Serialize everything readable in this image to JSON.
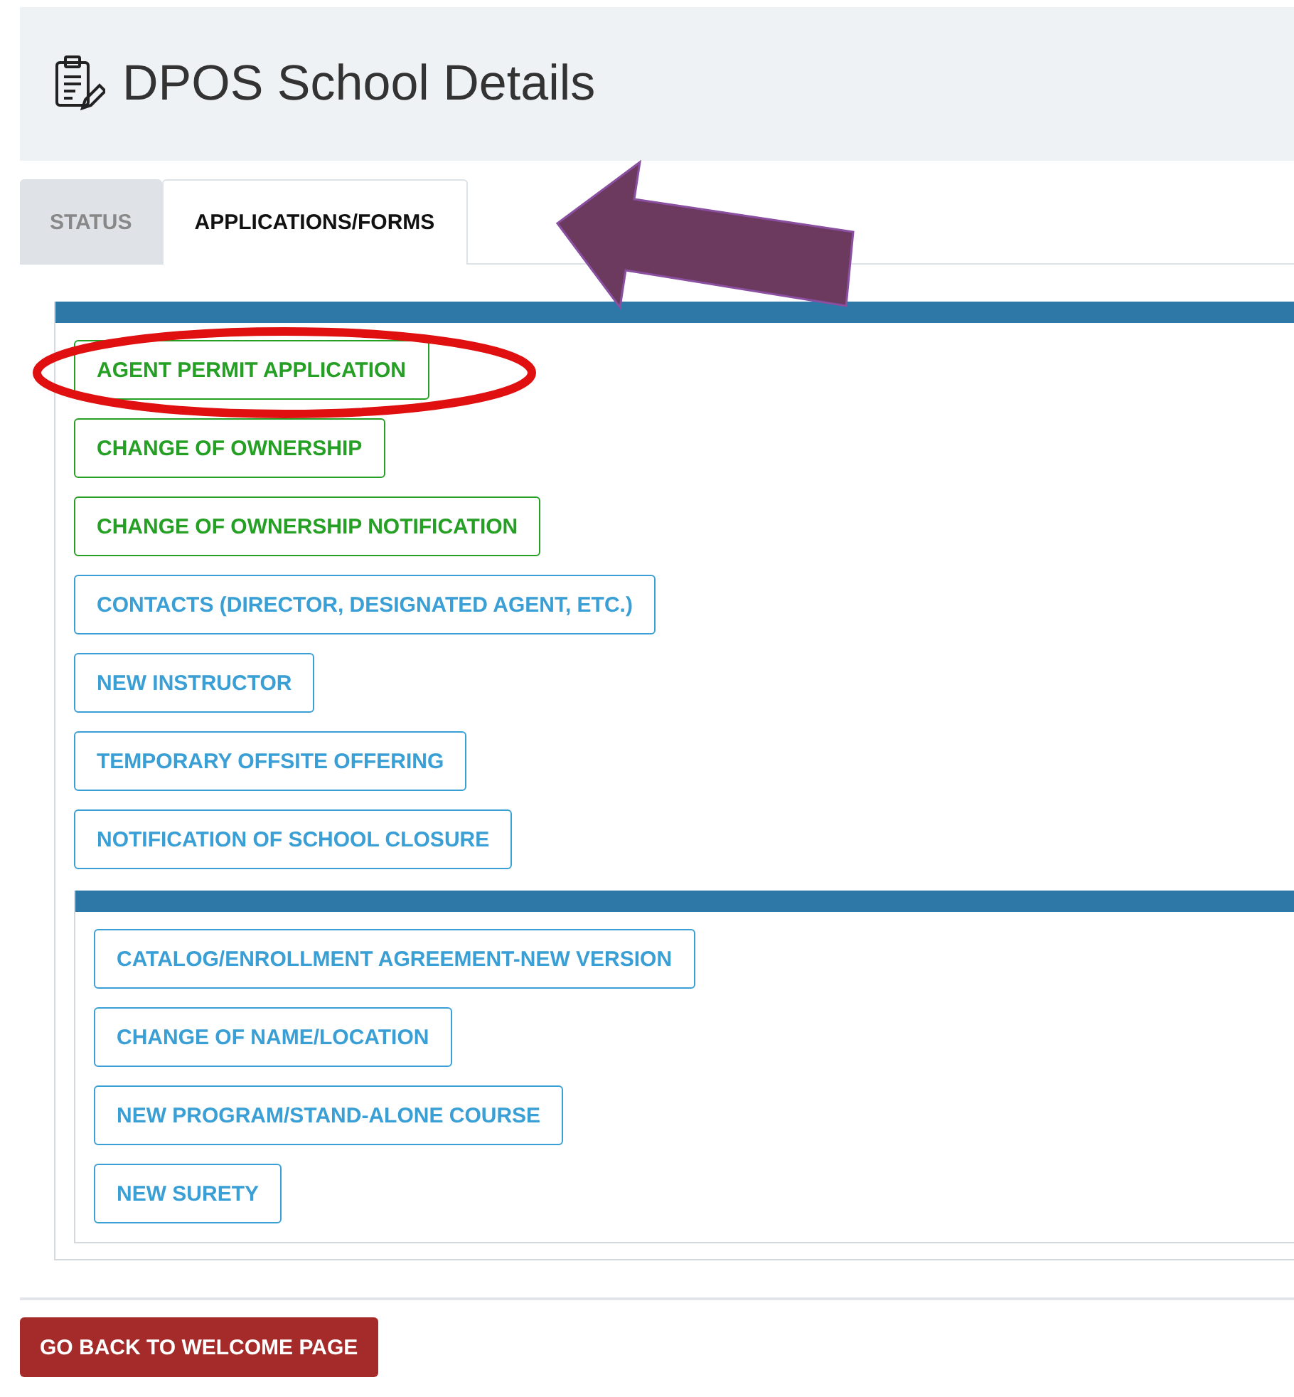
{
  "header": {
    "title": "DPOS School Details"
  },
  "tabs": [
    {
      "label": "STATUS",
      "selected": false
    },
    {
      "label": "APPLICATIONS/FORMS",
      "selected": true
    }
  ],
  "forms": [
    {
      "label": "AGENT PERMIT APPLICATION",
      "color": "#25a025"
    },
    {
      "label": "CHANGE OF OWNERSHIP",
      "color": "#25a025"
    },
    {
      "label": "CHANGE OF OWNERSHIP NOTIFICATION",
      "color": "#25a025"
    },
    {
      "label": "CONTACTS (DIRECTOR, DESIGNATED AGENT, ETC.)",
      "color": "#3a9fd5"
    },
    {
      "label": "NEW INSTRUCTOR",
      "color": "#3a9fd5"
    },
    {
      "label": "TEMPORARY OFFSITE OFFERING",
      "color": "#3a9fd5"
    },
    {
      "label": "NOTIFICATION OF SCHOOL CLOSURE",
      "color": "#3a9fd5"
    }
  ],
  "program_forms": [
    {
      "label": "CATALOG/ENROLLMENT AGREEMENT-NEW VERSION",
      "color": "#3a9fd5"
    },
    {
      "label": "CHANGE OF NAME/LOCATION",
      "color": "#3a9fd5"
    },
    {
      "label": "NEW PROGRAM/STAND-ALONE COURSE",
      "color": "#3a9fd5"
    },
    {
      "label": "NEW SURETY",
      "color": "#3a9fd5"
    }
  ],
  "back_button": "GO BACK TO WELCOME PAGE",
  "annotations": [
    {
      "kind": "ellipse",
      "color": "#e01010"
    },
    {
      "kind": "arrow",
      "color": "#6c3a5e"
    }
  ]
}
